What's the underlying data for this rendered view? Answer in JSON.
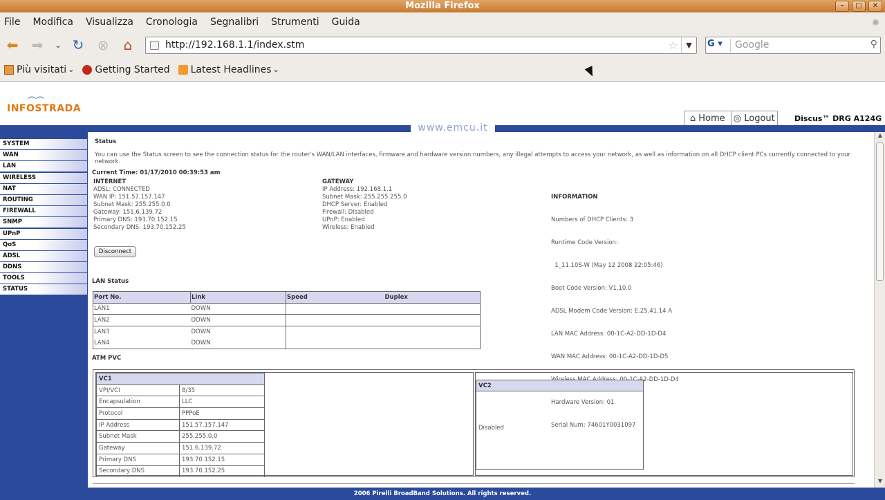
{
  "window": {
    "title": "Mozilla Firefox"
  },
  "menubar": {
    "items": [
      {
        "label": "File"
      },
      {
        "label": "Modifica"
      },
      {
        "label": "Visualizza"
      },
      {
        "label": "Cronologia"
      },
      {
        "label": "Segnalibri"
      },
      {
        "label": "Strumenti"
      },
      {
        "label": "Guida"
      }
    ]
  },
  "navbar": {
    "url": "http://192.168.1.1/index.stm",
    "search_placeholder": "Google",
    "search_engine": "G"
  },
  "bookmarks": {
    "items": [
      {
        "label": "Più visitati",
        "icon": "folder-icon"
      },
      {
        "label": "Getting Started",
        "icon": "firefox-icon"
      },
      {
        "label": "Latest Headlines",
        "icon": "rss-icon"
      }
    ]
  },
  "router": {
    "logo": "INFOSTRADA",
    "product": "Discus™ DRG A124G",
    "watermark": "www.emcu.it",
    "nav": {
      "home": "Home",
      "logout": "Logout"
    },
    "sidebar": [
      "SYSTEM",
      "WAN",
      "LAN",
      "WIRELESS",
      "NAT",
      "ROUTING",
      "FIREWALL",
      "SNMP",
      "UPnP",
      "QoS",
      "ADSL",
      "DDNS",
      "TOOLS",
      "STATUS"
    ],
    "footer": "2006 Pirelli BroadBand Solutions. All rights reserved."
  },
  "status": {
    "title": "Status",
    "description": "You can use the Status screen to see the connection status for the router's WAN/LAN interfaces, firmware and hardware version numbers, any illegal attempts to access your network, as well as information on all DHCP client PCs currently connected to your network.",
    "current_time": "Current Time: 01/17/2010 00:39:53 am",
    "internet": {
      "heading": "INTERNET",
      "lines": [
        "ADSL: CONNECTED",
        "WAN IP: 151.57.157.147",
        "Subnet Mask: 255.255.0.0",
        "Gateway: 151.6.139.72",
        "Primary DNS: 193.70.152.15",
        "Secondary DNS: 193.70.152.25"
      ]
    },
    "gateway": {
      "heading": "GATEWAY",
      "lines": [
        "IP Address: 192.168.1.1",
        "Subnet Mask: 255.255.255.0",
        "DHCP Server: Enabled",
        "Firewall: Disabled",
        "UPnP: Enabled",
        "Wireless: Enabled"
      ]
    },
    "information": {
      "heading": "INFORMATION",
      "lines": [
        "Numbers of DHCP Clients: 3",
        "Runtime Code Version:",
        "  1_11.10S-W (May 12 2008 22:05:46)",
        "Boot Code Version: V1.10.0",
        "ADSL Modem Code Version: E.25.41.14 A",
        "LAN MAC Address: 00-1C-A2-DD-1D-D4",
        "WAN MAC Address: 00-1C-A2-DD-1D-D5",
        "Wireless MAC Address: 00-1C-A2-DD-1D-D4",
        "Hardware Version: 01",
        "Serial Num: 74601Y0031097"
      ]
    },
    "disconnect_label": "Disconnect",
    "lan_status": {
      "title": "LAN Status",
      "headers": [
        "Port No.",
        "Link",
        "Speed",
        "Duplex"
      ],
      "rows": [
        [
          "LAN1",
          "DOWN"
        ],
        [
          "LAN2",
          "DOWN"
        ],
        [
          "LAN3",
          "DOWN"
        ],
        [
          "LAN4",
          "DOWN"
        ]
      ]
    },
    "atm": {
      "title": "ATM PVC",
      "vc1": {
        "heading": "VC1",
        "rows": [
          [
            "VPI/VCI",
            "8/35"
          ],
          [
            "Encapsulation",
            "LLC"
          ],
          [
            "Protocol",
            "PPPoE"
          ],
          [
            "IP Address",
            "151.57.157.147"
          ],
          [
            "Subnet Mask",
            "255.255.0.0"
          ],
          [
            "Gateway",
            "151.6.139.72"
          ],
          [
            "Primary DNS",
            "193.70.152.15"
          ],
          [
            "Secondary DNS",
            "193.70.152.25"
          ]
        ]
      },
      "vc2": {
        "heading": "VC2",
        "state": "Disabled"
      }
    }
  }
}
